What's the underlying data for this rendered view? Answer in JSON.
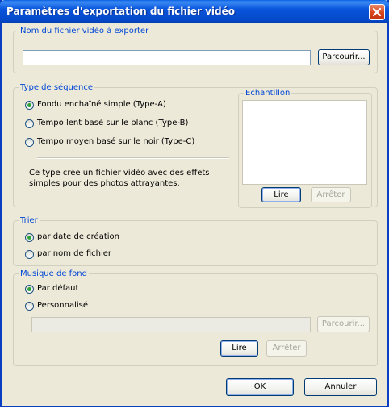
{
  "window": {
    "title": "Paramètres d'exportation du fichier vidéo"
  },
  "filename_group": {
    "legend": "Nom du fichier vidéo à exporter",
    "value": "",
    "browse_label": "Parcourir..."
  },
  "sequence_group": {
    "legend": "Type de séquence",
    "options": [
      {
        "label": "Fondu enchaîné simple (Type-A)",
        "checked": true
      },
      {
        "label": "Tempo lent basé sur le blanc (Type-B)",
        "checked": false
      },
      {
        "label": "Tempo moyen basé sur le noir (Type-C)",
        "checked": false
      }
    ],
    "description_line1": "Ce type crée un fichier vidéo avec des effets",
    "description_line2": "simples pour des photos attrayantes.",
    "sample": {
      "legend": "Echantillon",
      "play_label": "Lire",
      "stop_label": "Arrêter"
    }
  },
  "sort_group": {
    "legend": "Trier",
    "options": [
      {
        "label": "par date de création",
        "checked": true
      },
      {
        "label": "par nom de fichier",
        "checked": false
      }
    ]
  },
  "music_group": {
    "legend": "Musique de fond",
    "options": [
      {
        "label": "Par défaut",
        "checked": true
      },
      {
        "label": "Personnalisé",
        "checked": false
      }
    ],
    "path_value": "",
    "browse_label": "Parcourir...",
    "play_label": "Lire",
    "stop_label": "Arrêter"
  },
  "footer": {
    "ok_label": "OK",
    "cancel_label": "Annuler"
  },
  "colors": {
    "title_bar": "#0854dc",
    "legend_text": "#0046d5",
    "close_button": "#d8431a",
    "radio_dot": "#2fa33b"
  }
}
